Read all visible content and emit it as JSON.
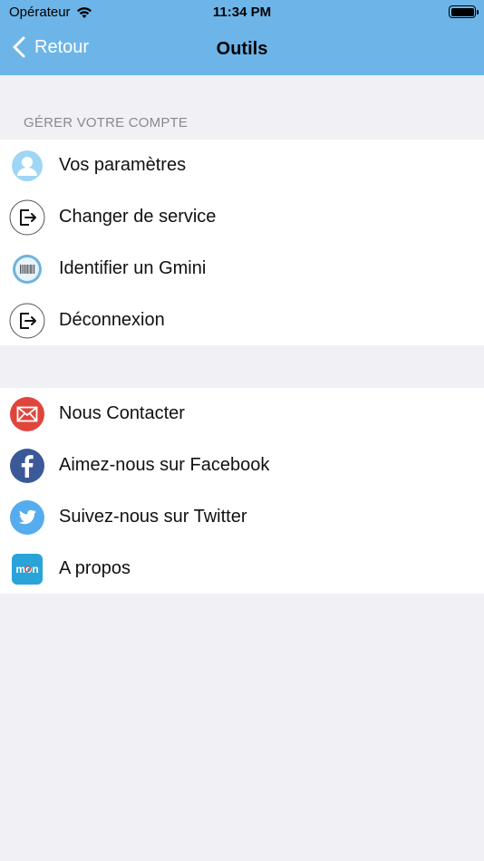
{
  "status_bar": {
    "carrier": "Opérateur",
    "time": "11:34 PM"
  },
  "nav": {
    "back_label": "Retour",
    "title": "Outils"
  },
  "sections": {
    "account_header": "GÉRER VOTRE COMPTE"
  },
  "account_items": [
    {
      "label": "Vos paramètres",
      "icon": "user-icon"
    },
    {
      "label": "Changer de service",
      "icon": "switch-service-icon"
    },
    {
      "label": "Identifier un Gmini",
      "icon": "barcode-icon"
    },
    {
      "label": "Déconnexion",
      "icon": "logout-icon"
    }
  ],
  "other_items": [
    {
      "label": "Nous Contacter",
      "icon": "mail-icon"
    },
    {
      "label": "Aimez-nous sur Facebook",
      "icon": "facebook-icon"
    },
    {
      "label": "Suivez-nous sur Twitter",
      "icon": "twitter-icon"
    },
    {
      "label": "A propos",
      "icon": "app-logo-icon"
    }
  ],
  "app_logo_text": "mon",
  "colors": {
    "nav_bar": "#6db5e8",
    "background": "#f0f0f5",
    "mail": "#e0453b",
    "facebook": "#3b5998",
    "twitter": "#55acee",
    "app_logo": "#2aa3d8"
  }
}
